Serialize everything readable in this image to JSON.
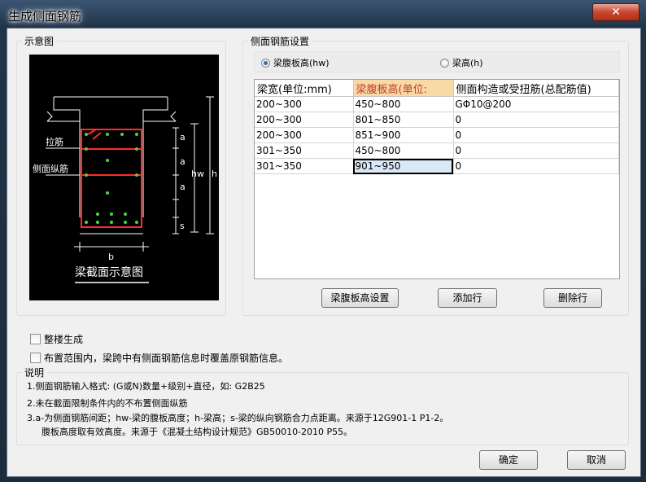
{
  "window": {
    "title": "生成侧面钢筋",
    "close_label": "✕"
  },
  "diagram_panel": {
    "legend": "示意图",
    "labels": {
      "tie": "拉筋",
      "side_bar": "侧面纵筋",
      "b": "b",
      "a1": "a",
      "a2": "a",
      "a3": "a",
      "hw": "hw",
      "h": "h",
      "s": "s",
      "caption": "梁截面示意图"
    }
  },
  "settings_panel": {
    "legend": "侧面钢筋设置",
    "radio_web": "梁腹板高(hw)",
    "radio_beam": "梁高(h)",
    "columns": [
      "梁宽(单位:mm)",
      "梁腹板高(单位:",
      "侧面构造或受扭筋(总配筋值)"
    ],
    "rows": [
      [
        "200~300",
        "450~800",
        "GΦ10@200"
      ],
      [
        "200~300",
        "801~850",
        "0"
      ],
      [
        "200~300",
        "851~900",
        "0"
      ],
      [
        "301~350",
        "450~800",
        "0"
      ],
      [
        "301~350",
        "901~950",
        "0"
      ]
    ],
    "buttons": {
      "web_height": "梁腹板高设置",
      "add_row": "添加行",
      "delete_row": "删除行"
    }
  },
  "options": {
    "whole_building": "整楼生成",
    "overwrite": "布置范围内，梁跨中有侧面钢筋信息时覆盖原钢筋信息。"
  },
  "description": {
    "legend": "说明",
    "lines": [
      "1.侧面钢筋输入格式: (G或N)数量+级别+直径，如: G2B25",
      "2.未在截面限制条件内的不布置侧面纵筋",
      "3.a-为侧面钢筋间距；hw-梁的腹板高度；h-梁高；s-梁的纵向钢筋合力点距离。来源于12G901-1 P1-2。",
      "腹板高度取有效高度。来源于《混凝土结构设计规范》GB50010-2010 P55。"
    ]
  },
  "footer": {
    "ok": "确定",
    "cancel": "取消"
  }
}
